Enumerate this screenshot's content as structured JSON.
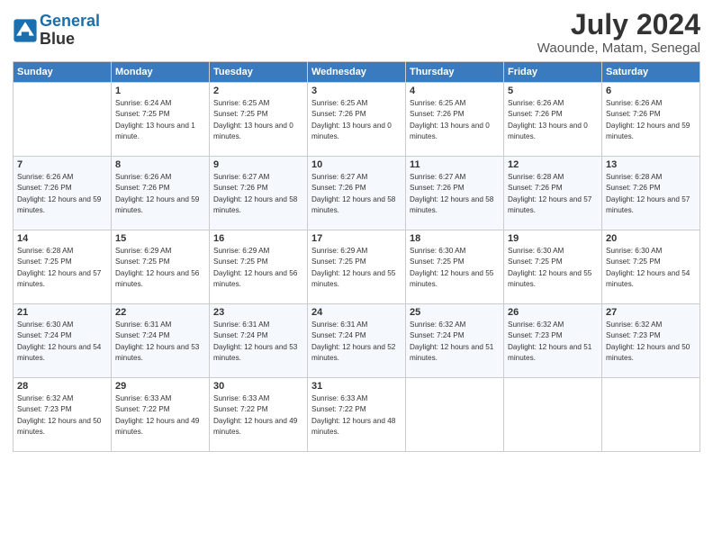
{
  "logo": {
    "line1": "General",
    "line2": "Blue"
  },
  "header": {
    "month": "July 2024",
    "location": "Waounde, Matam, Senegal"
  },
  "weekdays": [
    "Sunday",
    "Monday",
    "Tuesday",
    "Wednesday",
    "Thursday",
    "Friday",
    "Saturday"
  ],
  "weeks": [
    [
      {
        "day": "",
        "sunrise": "",
        "sunset": "",
        "daylight": ""
      },
      {
        "day": "1",
        "sunrise": "Sunrise: 6:24 AM",
        "sunset": "Sunset: 7:25 PM",
        "daylight": "Daylight: 13 hours and 1 minute."
      },
      {
        "day": "2",
        "sunrise": "Sunrise: 6:25 AM",
        "sunset": "Sunset: 7:25 PM",
        "daylight": "Daylight: 13 hours and 0 minutes."
      },
      {
        "day": "3",
        "sunrise": "Sunrise: 6:25 AM",
        "sunset": "Sunset: 7:26 PM",
        "daylight": "Daylight: 13 hours and 0 minutes."
      },
      {
        "day": "4",
        "sunrise": "Sunrise: 6:25 AM",
        "sunset": "Sunset: 7:26 PM",
        "daylight": "Daylight: 13 hours and 0 minutes."
      },
      {
        "day": "5",
        "sunrise": "Sunrise: 6:26 AM",
        "sunset": "Sunset: 7:26 PM",
        "daylight": "Daylight: 13 hours and 0 minutes."
      },
      {
        "day": "6",
        "sunrise": "Sunrise: 6:26 AM",
        "sunset": "Sunset: 7:26 PM",
        "daylight": "Daylight: 12 hours and 59 minutes."
      }
    ],
    [
      {
        "day": "7",
        "sunrise": "Sunrise: 6:26 AM",
        "sunset": "Sunset: 7:26 PM",
        "daylight": "Daylight: 12 hours and 59 minutes."
      },
      {
        "day": "8",
        "sunrise": "Sunrise: 6:26 AM",
        "sunset": "Sunset: 7:26 PM",
        "daylight": "Daylight: 12 hours and 59 minutes."
      },
      {
        "day": "9",
        "sunrise": "Sunrise: 6:27 AM",
        "sunset": "Sunset: 7:26 PM",
        "daylight": "Daylight: 12 hours and 58 minutes."
      },
      {
        "day": "10",
        "sunrise": "Sunrise: 6:27 AM",
        "sunset": "Sunset: 7:26 PM",
        "daylight": "Daylight: 12 hours and 58 minutes."
      },
      {
        "day": "11",
        "sunrise": "Sunrise: 6:27 AM",
        "sunset": "Sunset: 7:26 PM",
        "daylight": "Daylight: 12 hours and 58 minutes."
      },
      {
        "day": "12",
        "sunrise": "Sunrise: 6:28 AM",
        "sunset": "Sunset: 7:26 PM",
        "daylight": "Daylight: 12 hours and 57 minutes."
      },
      {
        "day": "13",
        "sunrise": "Sunrise: 6:28 AM",
        "sunset": "Sunset: 7:26 PM",
        "daylight": "Daylight: 12 hours and 57 minutes."
      }
    ],
    [
      {
        "day": "14",
        "sunrise": "Sunrise: 6:28 AM",
        "sunset": "Sunset: 7:25 PM",
        "daylight": "Daylight: 12 hours and 57 minutes."
      },
      {
        "day": "15",
        "sunrise": "Sunrise: 6:29 AM",
        "sunset": "Sunset: 7:25 PM",
        "daylight": "Daylight: 12 hours and 56 minutes."
      },
      {
        "day": "16",
        "sunrise": "Sunrise: 6:29 AM",
        "sunset": "Sunset: 7:25 PM",
        "daylight": "Daylight: 12 hours and 56 minutes."
      },
      {
        "day": "17",
        "sunrise": "Sunrise: 6:29 AM",
        "sunset": "Sunset: 7:25 PM",
        "daylight": "Daylight: 12 hours and 55 minutes."
      },
      {
        "day": "18",
        "sunrise": "Sunrise: 6:30 AM",
        "sunset": "Sunset: 7:25 PM",
        "daylight": "Daylight: 12 hours and 55 minutes."
      },
      {
        "day": "19",
        "sunrise": "Sunrise: 6:30 AM",
        "sunset": "Sunset: 7:25 PM",
        "daylight": "Daylight: 12 hours and 55 minutes."
      },
      {
        "day": "20",
        "sunrise": "Sunrise: 6:30 AM",
        "sunset": "Sunset: 7:25 PM",
        "daylight": "Daylight: 12 hours and 54 minutes."
      }
    ],
    [
      {
        "day": "21",
        "sunrise": "Sunrise: 6:30 AM",
        "sunset": "Sunset: 7:24 PM",
        "daylight": "Daylight: 12 hours and 54 minutes."
      },
      {
        "day": "22",
        "sunrise": "Sunrise: 6:31 AM",
        "sunset": "Sunset: 7:24 PM",
        "daylight": "Daylight: 12 hours and 53 minutes."
      },
      {
        "day": "23",
        "sunrise": "Sunrise: 6:31 AM",
        "sunset": "Sunset: 7:24 PM",
        "daylight": "Daylight: 12 hours and 53 minutes."
      },
      {
        "day": "24",
        "sunrise": "Sunrise: 6:31 AM",
        "sunset": "Sunset: 7:24 PM",
        "daylight": "Daylight: 12 hours and 52 minutes."
      },
      {
        "day": "25",
        "sunrise": "Sunrise: 6:32 AM",
        "sunset": "Sunset: 7:24 PM",
        "daylight": "Daylight: 12 hours and 51 minutes."
      },
      {
        "day": "26",
        "sunrise": "Sunrise: 6:32 AM",
        "sunset": "Sunset: 7:23 PM",
        "daylight": "Daylight: 12 hours and 51 minutes."
      },
      {
        "day": "27",
        "sunrise": "Sunrise: 6:32 AM",
        "sunset": "Sunset: 7:23 PM",
        "daylight": "Daylight: 12 hours and 50 minutes."
      }
    ],
    [
      {
        "day": "28",
        "sunrise": "Sunrise: 6:32 AM",
        "sunset": "Sunset: 7:23 PM",
        "daylight": "Daylight: 12 hours and 50 minutes."
      },
      {
        "day": "29",
        "sunrise": "Sunrise: 6:33 AM",
        "sunset": "Sunset: 7:22 PM",
        "daylight": "Daylight: 12 hours and 49 minutes."
      },
      {
        "day": "30",
        "sunrise": "Sunrise: 6:33 AM",
        "sunset": "Sunset: 7:22 PM",
        "daylight": "Daylight: 12 hours and 49 minutes."
      },
      {
        "day": "31",
        "sunrise": "Sunrise: 6:33 AM",
        "sunset": "Sunset: 7:22 PM",
        "daylight": "Daylight: 12 hours and 48 minutes."
      },
      {
        "day": "",
        "sunrise": "",
        "sunset": "",
        "daylight": ""
      },
      {
        "day": "",
        "sunrise": "",
        "sunset": "",
        "daylight": ""
      },
      {
        "day": "",
        "sunrise": "",
        "sunset": "",
        "daylight": ""
      }
    ]
  ]
}
